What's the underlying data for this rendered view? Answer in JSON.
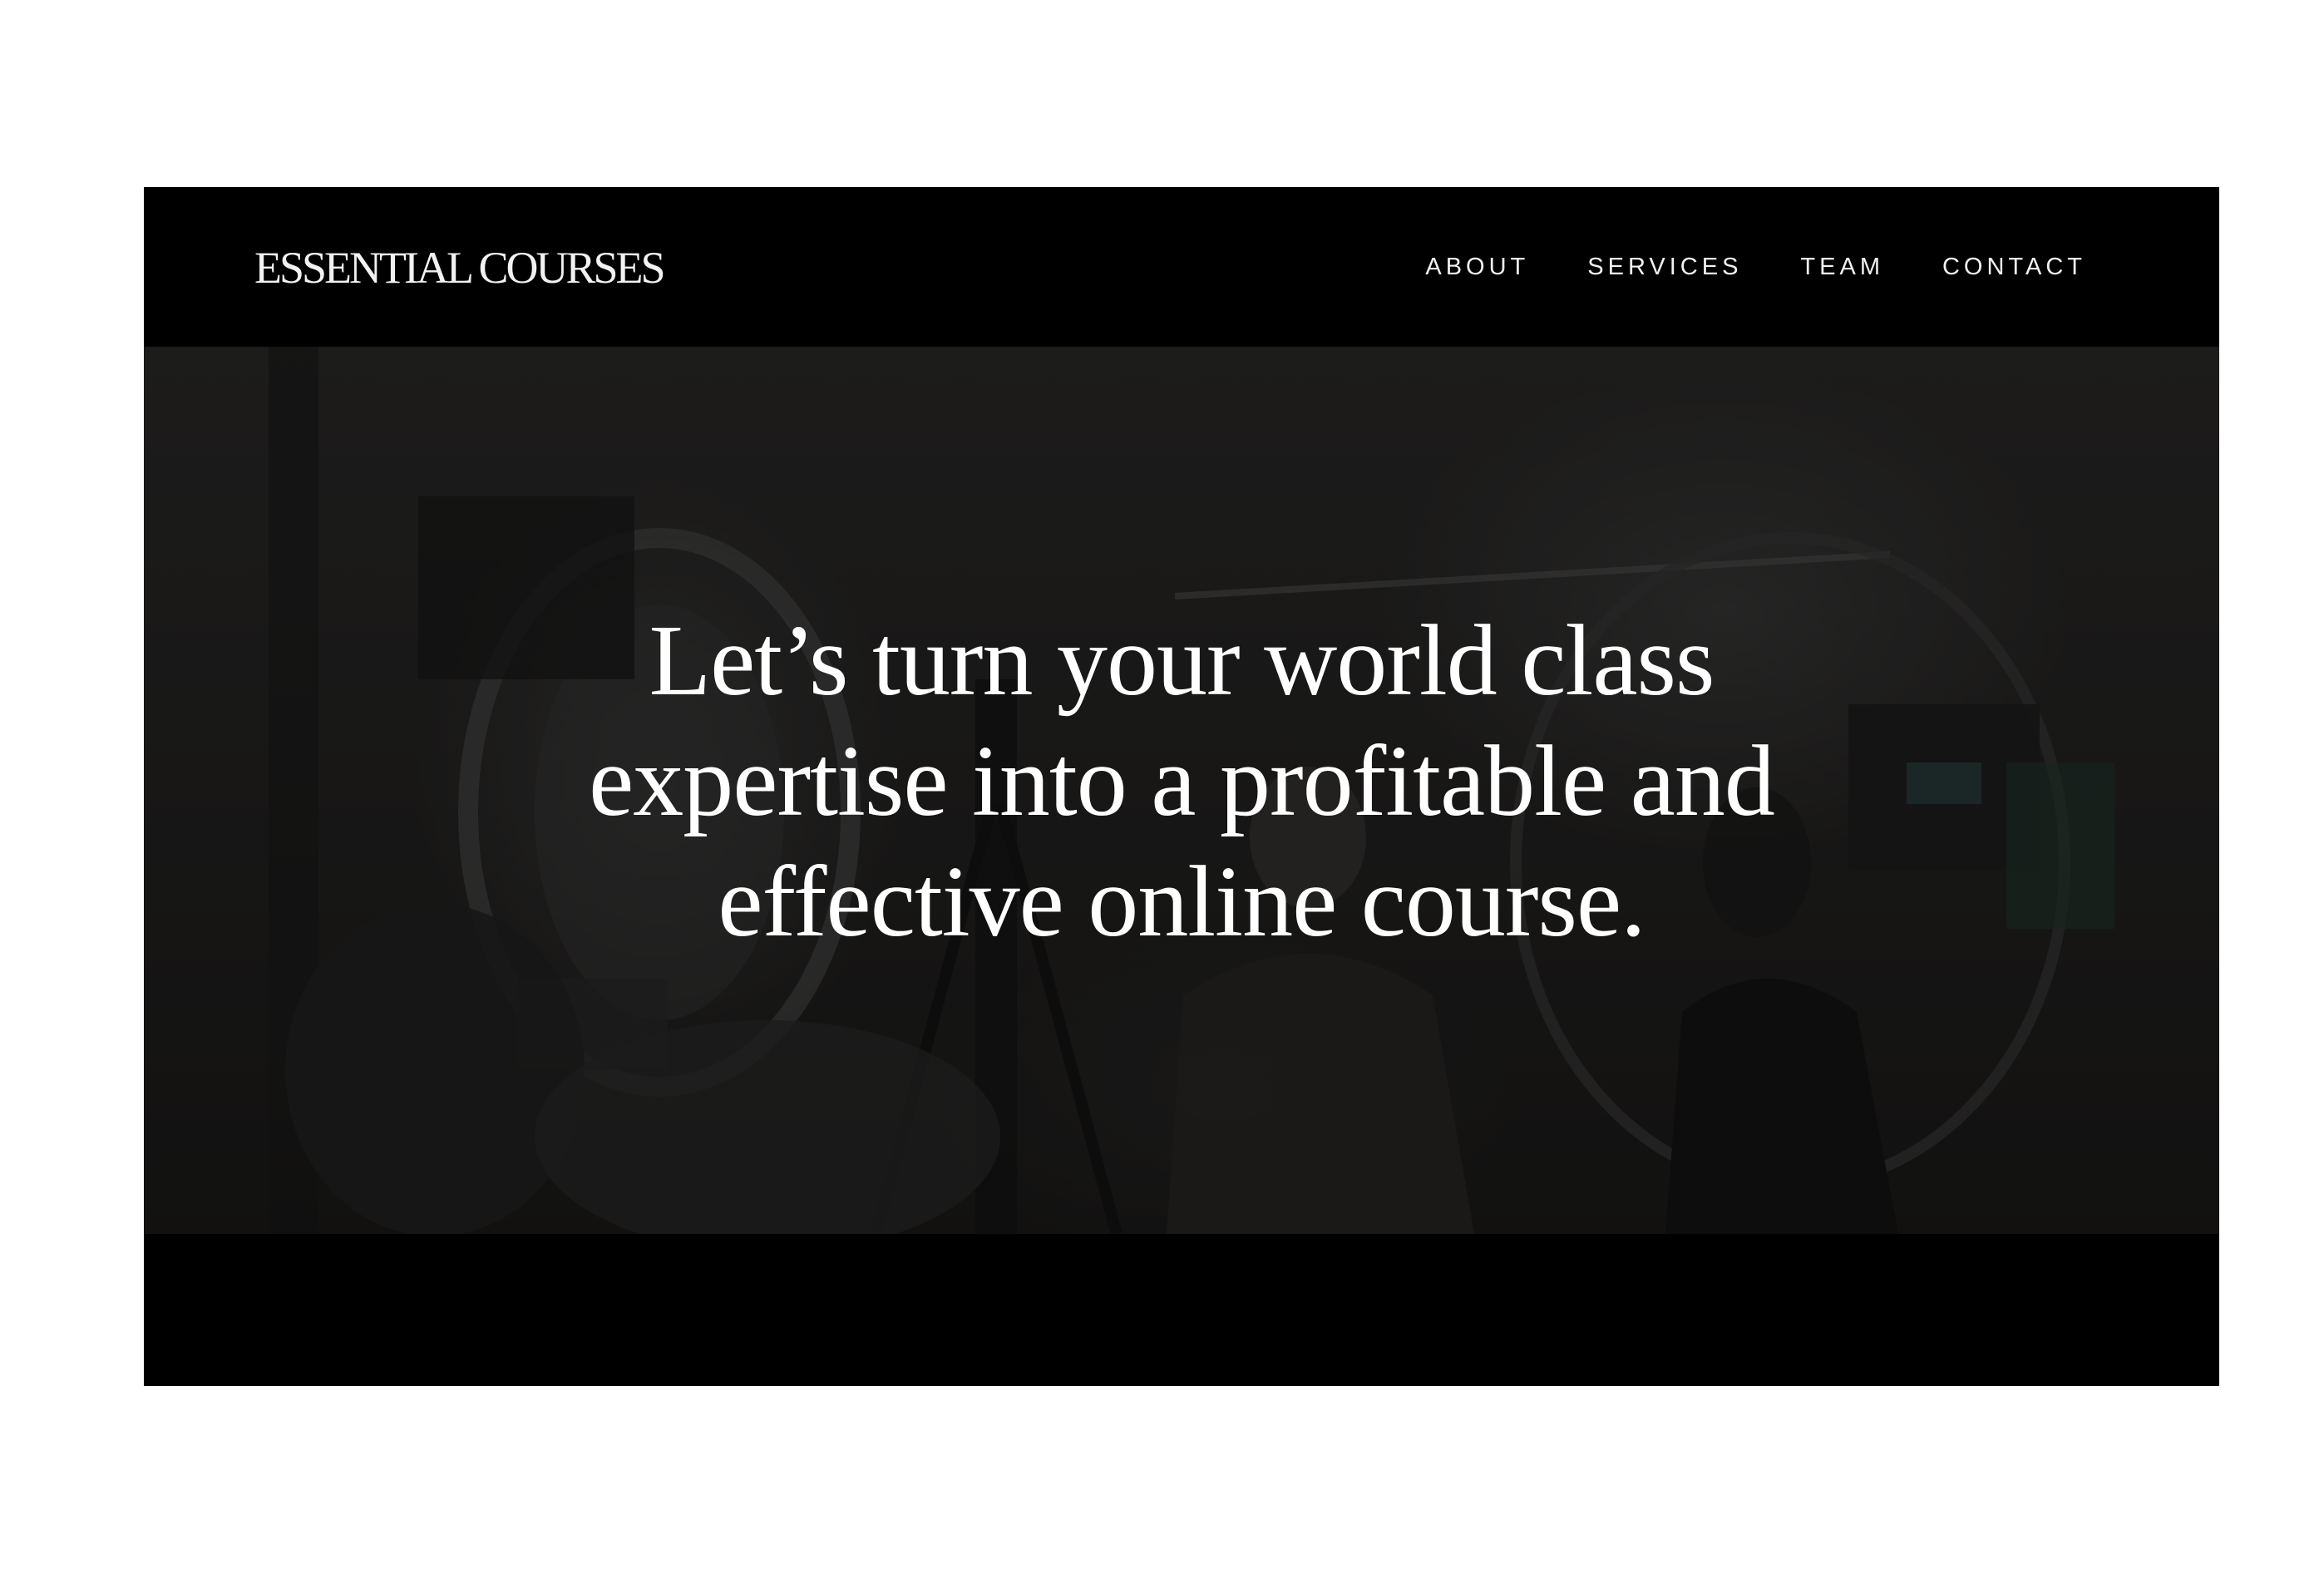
{
  "header": {
    "logo_text": "ESSENTIAL COURSES",
    "nav": [
      {
        "label": "ABOUT"
      },
      {
        "label": "SERVICES"
      },
      {
        "label": "TEAM"
      },
      {
        "label": "CONTACT"
      }
    ]
  },
  "hero": {
    "headline": "Let’s turn your world class expertise into a profitable and effective online course."
  },
  "colors": {
    "page_background": "#ffffff",
    "frame_background": "#000000",
    "text": "#ffffff"
  }
}
